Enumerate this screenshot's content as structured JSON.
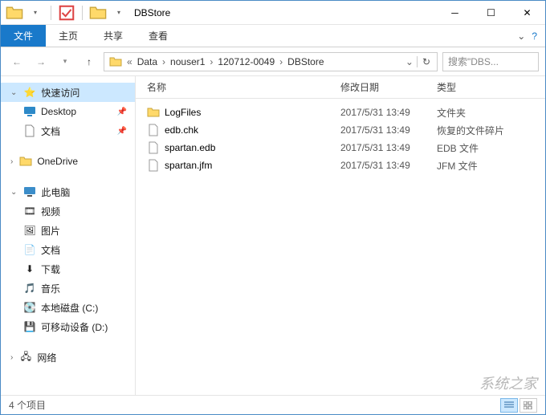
{
  "window": {
    "title": "DBStore"
  },
  "ribbon": {
    "file": "文件",
    "tabs": [
      "主页",
      "共享",
      "查看"
    ]
  },
  "breadcrumb": {
    "segments": [
      "Data",
      "nouser1",
      "120712-0049",
      "DBStore"
    ]
  },
  "search": {
    "placeholder": "搜索\"DBS..."
  },
  "sidebar": {
    "quick_access": {
      "label": "快速访问",
      "items": [
        {
          "label": "Desktop",
          "pinned": true
        },
        {
          "label": "文档",
          "pinned": true
        }
      ]
    },
    "onedrive": {
      "label": "OneDrive"
    },
    "this_pc": {
      "label": "此电脑",
      "items": [
        {
          "label": "视频"
        },
        {
          "label": "图片"
        },
        {
          "label": "文档"
        },
        {
          "label": "下载"
        },
        {
          "label": "音乐"
        },
        {
          "label": "本地磁盘 (C:)"
        },
        {
          "label": "可移动设备 (D:)"
        }
      ]
    },
    "network": {
      "label": "网络"
    }
  },
  "columns": {
    "name": "名称",
    "date": "修改日期",
    "type": "类型"
  },
  "files": [
    {
      "name": "LogFiles",
      "date": "2017/5/31 13:49",
      "type": "文件夹",
      "kind": "folder"
    },
    {
      "name": "edb.chk",
      "date": "2017/5/31 13:49",
      "type": "恢复的文件碎片",
      "kind": "file"
    },
    {
      "name": "spartan.edb",
      "date": "2017/5/31 13:49",
      "type": "EDB 文件",
      "kind": "file"
    },
    {
      "name": "spartan.jfm",
      "date": "2017/5/31 13:49",
      "type": "JFM 文件",
      "kind": "file"
    }
  ],
  "status": {
    "count": "4 个项目"
  },
  "watermark": "系统之家"
}
